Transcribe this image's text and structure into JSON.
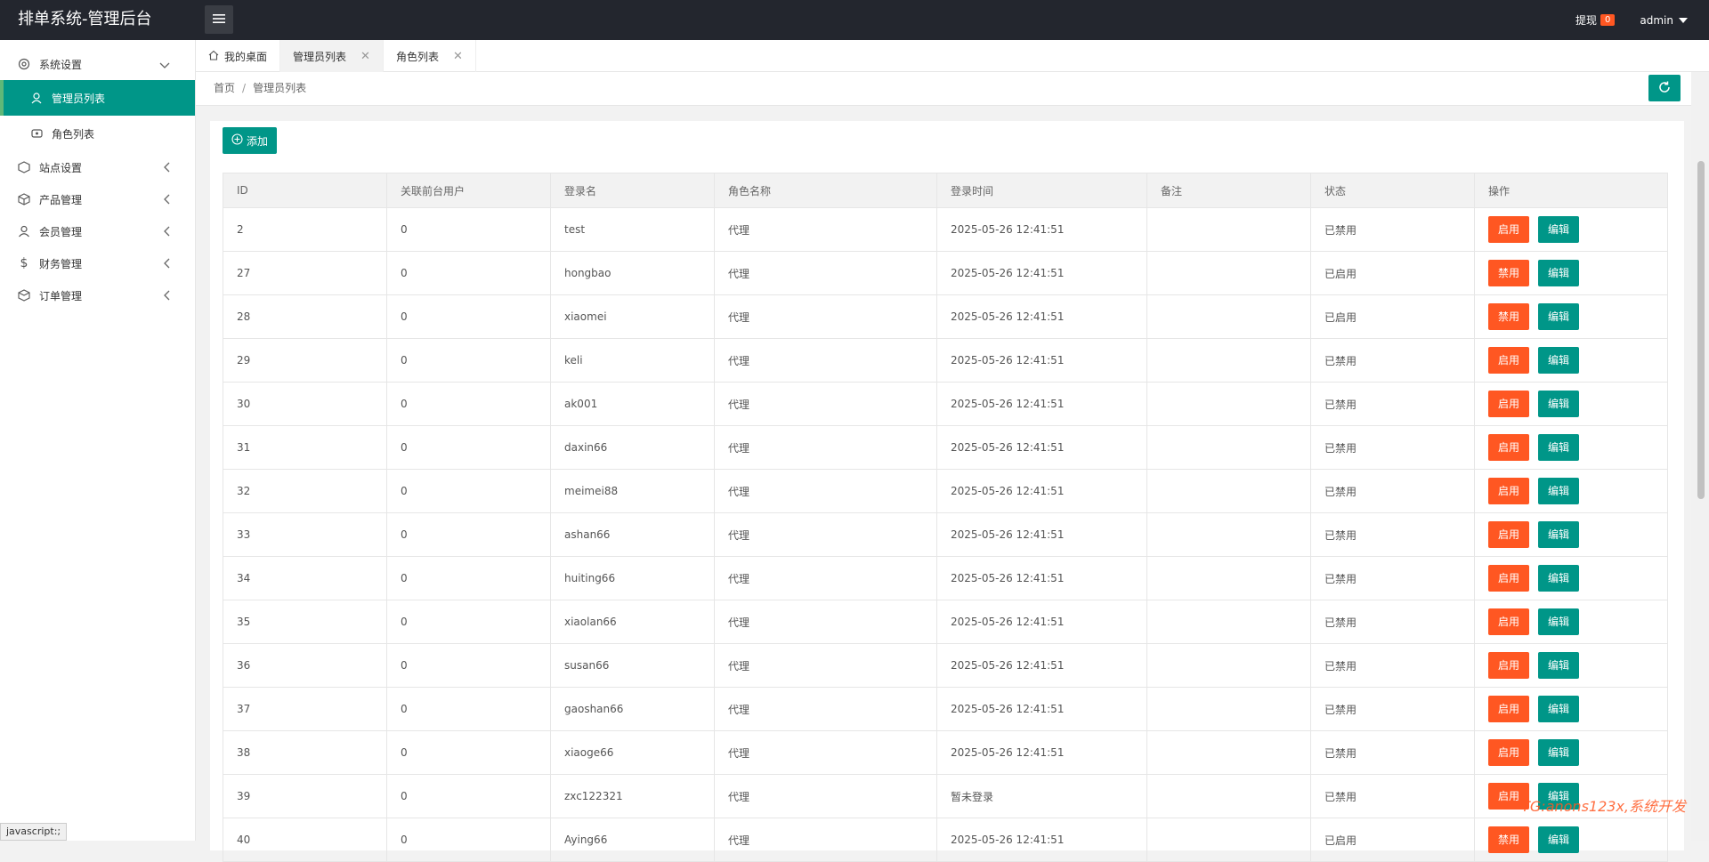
{
  "app": {
    "title": "排单系统-管理后台"
  },
  "header": {
    "withdraw_label": "提现",
    "withdraw_count": "0",
    "user": "admin"
  },
  "sidebar": {
    "items": [
      {
        "label": "系统设置",
        "icon": "gear-icon",
        "expanded": true
      },
      {
        "label": "站点设置",
        "icon": "cube-icon"
      },
      {
        "label": "产品管理",
        "icon": "box-icon"
      },
      {
        "label": "会员管理",
        "icon": "user-icon"
      },
      {
        "label": "财务管理",
        "icon": "dollar-icon"
      },
      {
        "label": "订单管理",
        "icon": "package-icon"
      }
    ],
    "sub": [
      {
        "label": "管理员列表",
        "icon": "admin-icon",
        "active": true
      },
      {
        "label": "角色列表",
        "icon": "role-icon"
      }
    ]
  },
  "tabs": [
    {
      "label": "我的桌面",
      "icon": "home-icon"
    },
    {
      "label": "管理员列表",
      "active": true
    },
    {
      "label": "角色列表"
    }
  ],
  "breadcrumb": {
    "home": "首页",
    "sep": "/",
    "current": "管理员列表"
  },
  "toolbar": {
    "add_label": "添加"
  },
  "table": {
    "headers": [
      "ID",
      "关联前台用户",
      "登录名",
      "角色名称",
      "登录时间",
      "备注",
      "状态",
      "操作"
    ],
    "rows": [
      {
        "id": "2",
        "fe": "0",
        "login": "test",
        "role": "代理",
        "time": "2025-05-26 12:41:51",
        "note": "",
        "status": "已禁用",
        "act": "启用",
        "edit": "编辑"
      },
      {
        "id": "27",
        "fe": "0",
        "login": "hongbao",
        "role": "代理",
        "time": "2025-05-26 12:41:51",
        "note": "",
        "status": "已启用",
        "act": "禁用",
        "edit": "编辑"
      },
      {
        "id": "28",
        "fe": "0",
        "login": "xiaomei",
        "role": "代理",
        "time": "2025-05-26 12:41:51",
        "note": "",
        "status": "已启用",
        "act": "禁用",
        "edit": "编辑"
      },
      {
        "id": "29",
        "fe": "0",
        "login": "keli",
        "role": "代理",
        "time": "2025-05-26 12:41:51",
        "note": "",
        "status": "已禁用",
        "act": "启用",
        "edit": "编辑"
      },
      {
        "id": "30",
        "fe": "0",
        "login": "ak001",
        "role": "代理",
        "time": "2025-05-26 12:41:51",
        "note": "",
        "status": "已禁用",
        "act": "启用",
        "edit": "编辑"
      },
      {
        "id": "31",
        "fe": "0",
        "login": "daxin66",
        "role": "代理",
        "time": "2025-05-26 12:41:51",
        "note": "",
        "status": "已禁用",
        "act": "启用",
        "edit": "编辑"
      },
      {
        "id": "32",
        "fe": "0",
        "login": "meimei88",
        "role": "代理",
        "time": "2025-05-26 12:41:51",
        "note": "",
        "status": "已禁用",
        "act": "启用",
        "edit": "编辑"
      },
      {
        "id": "33",
        "fe": "0",
        "login": "ashan66",
        "role": "代理",
        "time": "2025-05-26 12:41:51",
        "note": "",
        "status": "已禁用",
        "act": "启用",
        "edit": "编辑"
      },
      {
        "id": "34",
        "fe": "0",
        "login": "huiting66",
        "role": "代理",
        "time": "2025-05-26 12:41:51",
        "note": "",
        "status": "已禁用",
        "act": "启用",
        "edit": "编辑"
      },
      {
        "id": "35",
        "fe": "0",
        "login": "xiaolan66",
        "role": "代理",
        "time": "2025-05-26 12:41:51",
        "note": "",
        "status": "已禁用",
        "act": "启用",
        "edit": "编辑"
      },
      {
        "id": "36",
        "fe": "0",
        "login": "susan66",
        "role": "代理",
        "time": "2025-05-26 12:41:51",
        "note": "",
        "status": "已禁用",
        "act": "启用",
        "edit": "编辑"
      },
      {
        "id": "37",
        "fe": "0",
        "login": "gaoshan66",
        "role": "代理",
        "time": "2025-05-26 12:41:51",
        "note": "",
        "status": "已禁用",
        "act": "启用",
        "edit": "编辑"
      },
      {
        "id": "38",
        "fe": "0",
        "login": "xiaoge66",
        "role": "代理",
        "time": "2025-05-26 12:41:51",
        "note": "",
        "status": "已禁用",
        "act": "启用",
        "edit": "编辑"
      },
      {
        "id": "39",
        "fe": "0",
        "login": "zxc122321",
        "role": "代理",
        "time": "暂未登录",
        "note": "",
        "status": "已禁用",
        "act": "启用",
        "edit": "编辑"
      },
      {
        "id": "40",
        "fe": "0",
        "login": "Aying66",
        "role": "代理",
        "time": "2025-05-26 12:41:51",
        "note": "",
        "status": "已启用",
        "act": "禁用",
        "edit": "编辑"
      }
    ]
  },
  "statusbar": {
    "text": "javascript:;"
  },
  "watermark": "TG:anons123x,系统开发",
  "colors": {
    "primary": "#009688",
    "danger": "#ff5722",
    "header_bg": "#23262e"
  }
}
